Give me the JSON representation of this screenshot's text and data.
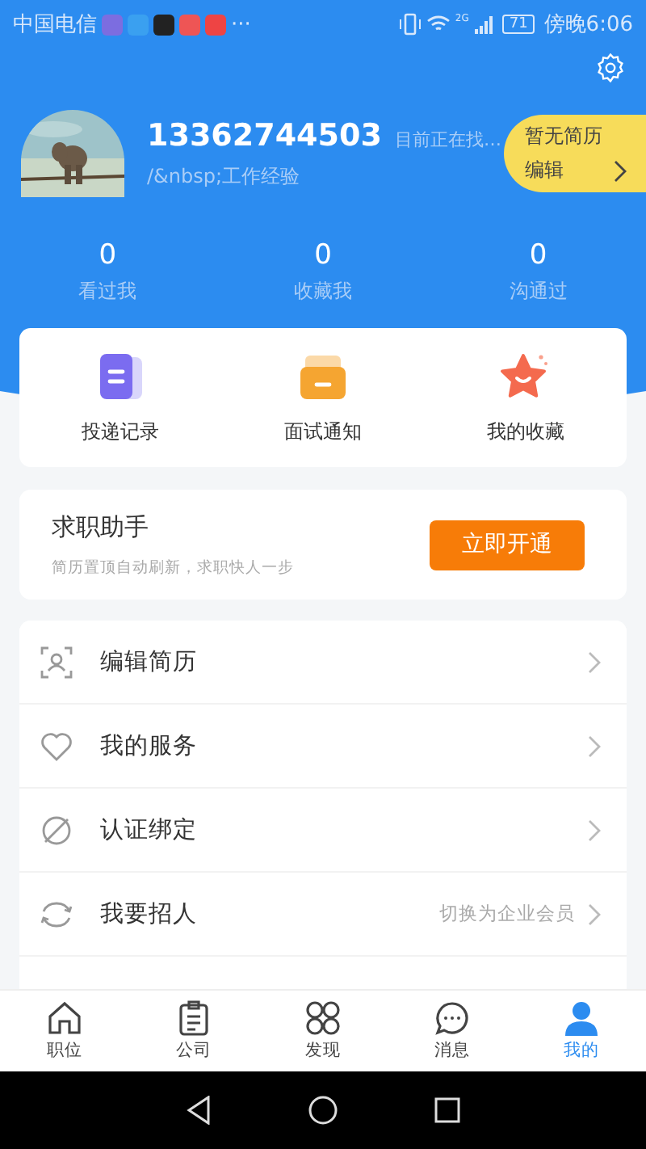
{
  "status_bar": {
    "carrier": "中国电信",
    "more": "···",
    "network": "2G",
    "battery": "71",
    "time": "傍晚6:06"
  },
  "profile": {
    "phone": "13362744503",
    "status": "目前正在找…",
    "subtitle": "/&nbsp;工作经验",
    "resume_badge": {
      "title": "暂无简历",
      "action": "编辑"
    }
  },
  "stats": [
    {
      "count": "0",
      "label": "看过我"
    },
    {
      "count": "0",
      "label": "收藏我"
    },
    {
      "count": "0",
      "label": "沟通过"
    }
  ],
  "shortcuts": [
    {
      "kind": "records",
      "label": "投递记录"
    },
    {
      "kind": "interview",
      "label": "面试通知"
    },
    {
      "kind": "favorites",
      "label": "我的收藏"
    }
  ],
  "helper": {
    "title": "求职助手",
    "subtitle": "简历置顶自动刷新，求职快人一步",
    "button": "立即开通"
  },
  "menu": [
    {
      "kind": "resume",
      "label": "编辑简历"
    },
    {
      "kind": "service",
      "label": "我的服务"
    },
    {
      "kind": "verify",
      "label": "认证绑定"
    },
    {
      "kind": "recruit",
      "label": "我要招人",
      "note": "切换为企业会员"
    }
  ],
  "tabs": [
    {
      "kind": "jobs",
      "label": "职位",
      "selected": false
    },
    {
      "kind": "company",
      "label": "公司",
      "selected": false
    },
    {
      "kind": "discover",
      "label": "发现",
      "selected": false
    },
    {
      "kind": "messages",
      "label": "消息",
      "selected": false
    },
    {
      "kind": "me",
      "label": "我的",
      "selected": true
    }
  ]
}
